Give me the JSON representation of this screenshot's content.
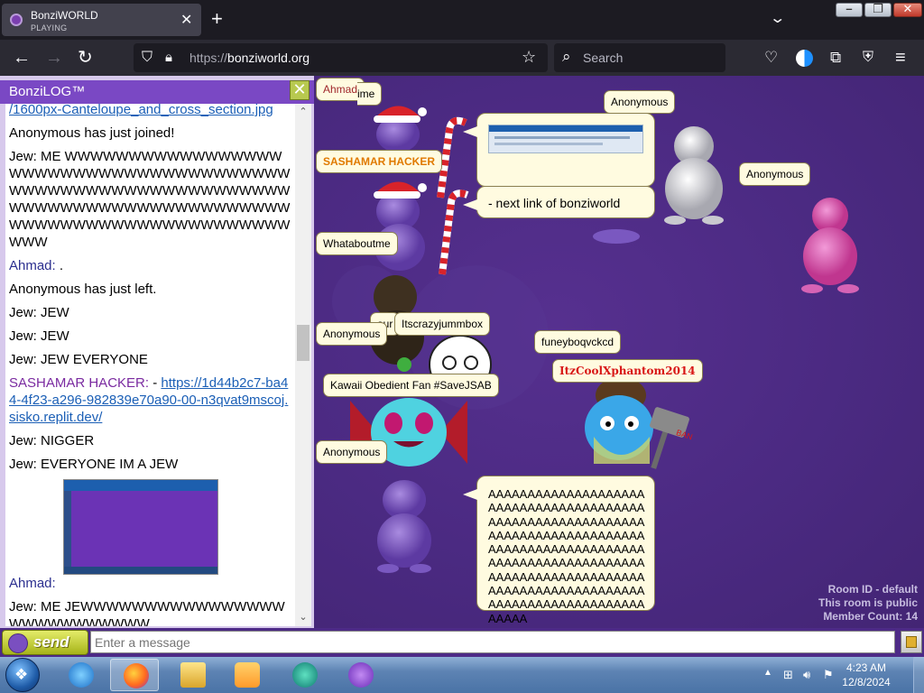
{
  "browser": {
    "tab_title": "BonziWORLD",
    "tab_status": "PLAYING",
    "close_tab": "✕",
    "new_tab": "+",
    "url_scheme": "https://",
    "url_host": "bonziworld.org",
    "search_placeholder": "Search"
  },
  "log": {
    "title": "BonziLOG™",
    "close": "✕",
    "lines": [
      {
        "name": "",
        "text": "/1600px-Canteloupe_and_cross_section.jpg",
        "link": true
      },
      {
        "name": "",
        "text": "Anonymous has just joined!"
      },
      {
        "name": "Jew:",
        "text": " ME WWWWWWWWWWWWWWWWWWWWWWWWWWWWWWWWWWWWWWWWWWWWWWWWWWWWWWWWWWWWWWWWWWWWWWWWWWWWWWWWWWWWWWWWWWWWWWWWWWWWWWWWWWWW"
      },
      {
        "name": "Ahmad:",
        "text": " .",
        "cls": "nm-a"
      },
      {
        "name": "",
        "text": "Anonymous has just left."
      },
      {
        "name": "Jew:",
        "text": " JEW"
      },
      {
        "name": "Jew:",
        "text": " JEW"
      },
      {
        "name": "Jew:",
        "text": " JEW EVERYONE"
      },
      {
        "name": "SASHAMAR HACKER:",
        "text": " - ",
        "cls": "nm-s",
        "href": "https://1d44b2c7-ba44-4f23-a296-982839e70a90-00-n3qvat9mscoj.sisko.replit.dev/"
      },
      {
        "name": "Jew:",
        "text": " NIGGER"
      },
      {
        "name": "Jew:",
        "text": " EVERYONE IM A JEW"
      },
      {
        "image": true
      },
      {
        "name": "Ahmad:",
        "text": "",
        "cls": "nm-a"
      },
      {
        "name": "Jew:",
        "text": " ME JEWWWWWWWWWWWWWWWWWWWWWWWWWWW"
      }
    ]
  },
  "room": {
    "nametags": {
      "ahmad": "Ahmad",
      "ime": "ime",
      "anonymous_top": "Anonymous",
      "sashamar": "SASHAMAR HACKER",
      "anonymous_right": "Anonymous",
      "whataboutme": "Whataboutme",
      "itscrazy": "Itscrazyjummbox",
      "anonymous_mid": "Anonymous",
      "funey": "funeyboqvckcd",
      "itzcool": "ItzCoolXphantom2014",
      "kawaii": "Kawaii Obedient Fan #SaveJSAB",
      "anonymous_low": "Anonymous",
      "partial": "aur"
    },
    "bubble_link": "- next link of bonziworld",
    "bubble_scream": "AAAAAAAAAAAAAAAAAAAAAAAAAAAAAAAAAAAAAAAAAAAAAAAAAAAAAAAAAAAAAAAAAAAAAAAAAAAAAAAAAAAAAAAAAAAAAAAAAAAAAAAAAAAAAAAAAAAAAAAAAAAAAAAAAAAAAAAAAAAAAAAAAAAAAAAAAAAAAAAAAAAAAAAAAAAAAAAAAAAAAAAAA",
    "room_id": "Room ID - default",
    "room_public": "This room is public",
    "member_count": "Member Count: 14",
    "ban_sign": "BAN"
  },
  "input": {
    "send_label": "send",
    "placeholder": "Enter a message"
  },
  "taskbar": {
    "time": "4:23 AM",
    "date": "12/8/2024"
  },
  "colors": {
    "room_bg": "#4b2a82",
    "log_title_bg": "#7a48c4",
    "bubble_bg": "#fffbe0",
    "tag_orange": "#e07a00",
    "tag_red": "#d81616"
  }
}
